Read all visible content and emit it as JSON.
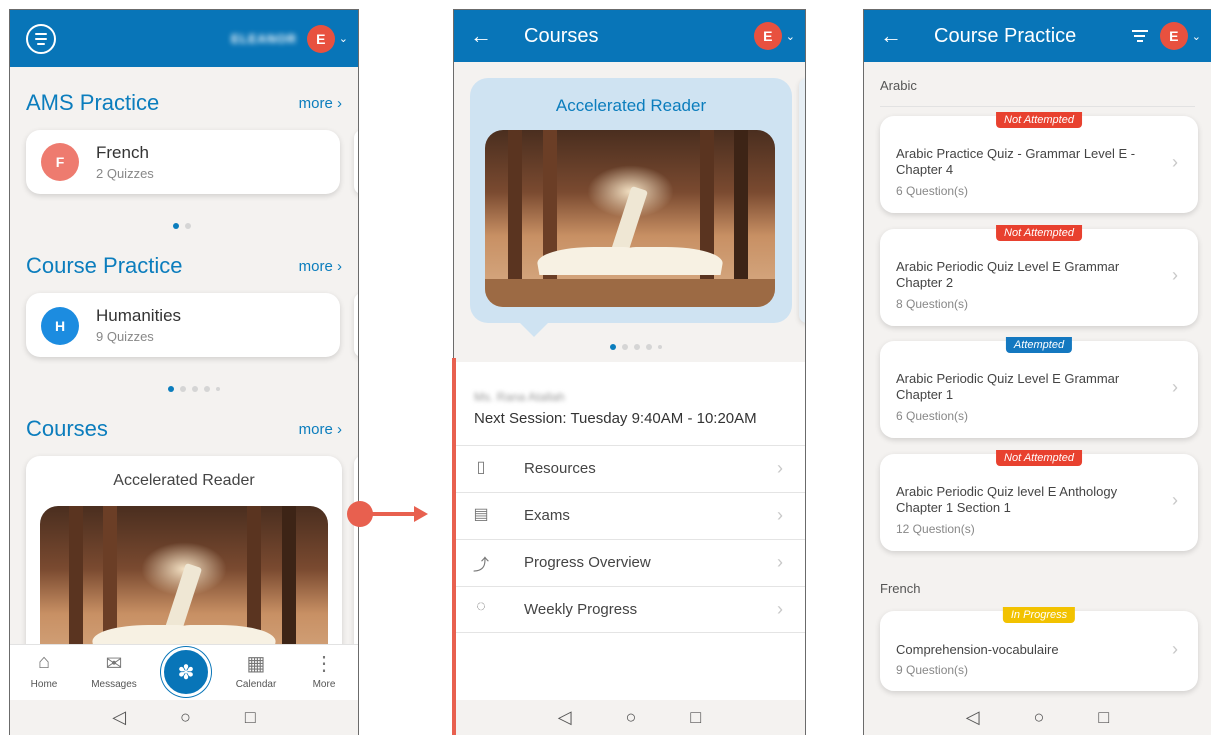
{
  "colors": {
    "primary": "#0875b8",
    "accent_red": "#e8604f",
    "not_attempted": "#e8412f",
    "attempted": "#1478c0",
    "in_progress": "#f2c200"
  },
  "screen1": {
    "user_name": "ELEANOR",
    "avatar_initial": "E",
    "sections": {
      "ams": {
        "title": "AMS Practice",
        "more": "more",
        "card": {
          "initial": "F",
          "title": "French",
          "sub": "2 Quizzes"
        }
      },
      "course_practice": {
        "title": "Course Practice",
        "more": "more",
        "card": {
          "initial": "H",
          "title": "Humanities",
          "sub": "9 Quizzes"
        }
      },
      "courses": {
        "title": "Courses",
        "more": "more",
        "card": {
          "title": "Accelerated Reader"
        }
      }
    },
    "bottom_nav": {
      "home": "Home",
      "messages": "Messages",
      "calendar": "Calendar",
      "more": "More"
    }
  },
  "screen2": {
    "title": "Courses",
    "avatar_initial": "E",
    "course_title": "Accelerated Reader",
    "teacher": "Ms. Rana Atallah",
    "next_session": "Next Session: Tuesday 9:40AM - 10:20AM",
    "menu": [
      "Resources",
      "Exams",
      "Progress Overview",
      "Weekly Progress"
    ]
  },
  "screen3": {
    "title": "Course Practice",
    "avatar_initial": "E",
    "groups": [
      {
        "label": "Arabic"
      },
      {
        "label": "French"
      }
    ],
    "quizzes": [
      {
        "status": "Not Attempted",
        "title": "Arabic Practice Quiz - Grammar Level E - Chapter 4",
        "sub": "6 Question(s)"
      },
      {
        "status": "Not Attempted",
        "title": "Arabic Periodic Quiz Level E Grammar Chapter 2",
        "sub": "8 Question(s)"
      },
      {
        "status": "Attempted",
        "title": "Arabic Periodic Quiz Level E Grammar Chapter 1",
        "sub": "6 Question(s)"
      },
      {
        "status": "Not Attempted",
        "title": "Arabic Periodic Quiz level E Anthology Chapter 1 Section 1",
        "sub": "12 Question(s)"
      },
      {
        "status": "In Progress",
        "title": "Comprehension-vocabulaire",
        "sub": "9 Question(s)"
      }
    ]
  },
  "sysnav": {
    "back": "◁",
    "home": "○",
    "recents": "□"
  }
}
